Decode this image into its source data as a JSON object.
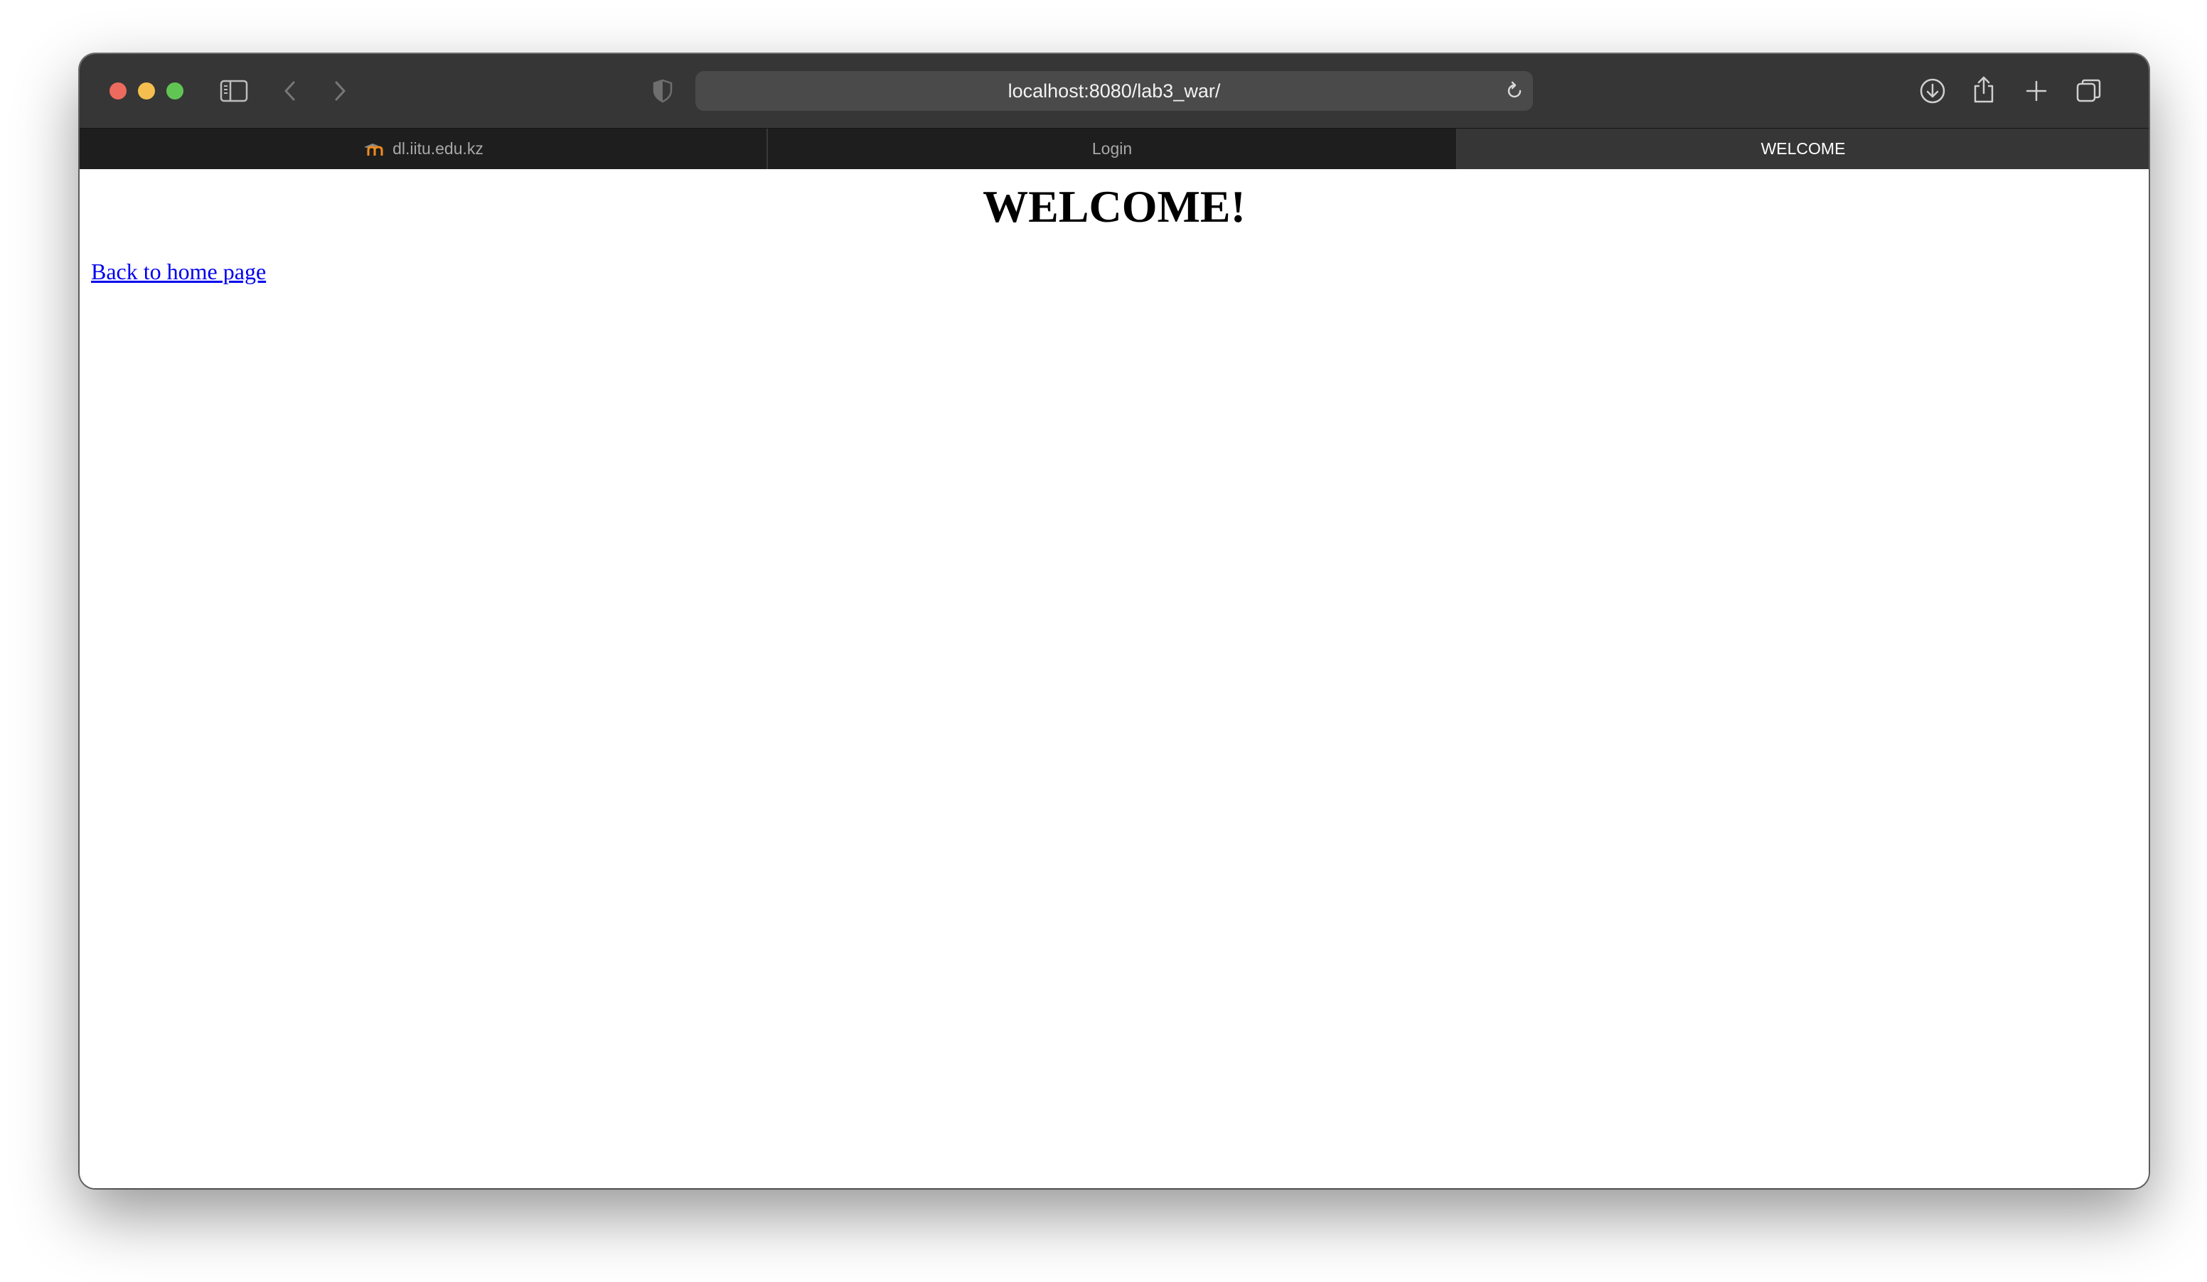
{
  "browser": {
    "url": "localhost:8080/lab3_war/",
    "tabs": [
      {
        "label": "dl.iitu.edu.kz",
        "icon": "moodle-favicon-icon",
        "active": false
      },
      {
        "label": "Login",
        "active": false
      },
      {
        "label": "WELCOME",
        "active": true
      }
    ]
  },
  "page": {
    "heading": "WELCOME!",
    "back_link": "Back to home page"
  },
  "colors": {
    "titlebar": "#363636",
    "tabbar": "#1e1e1e",
    "link": "#0000ee"
  }
}
